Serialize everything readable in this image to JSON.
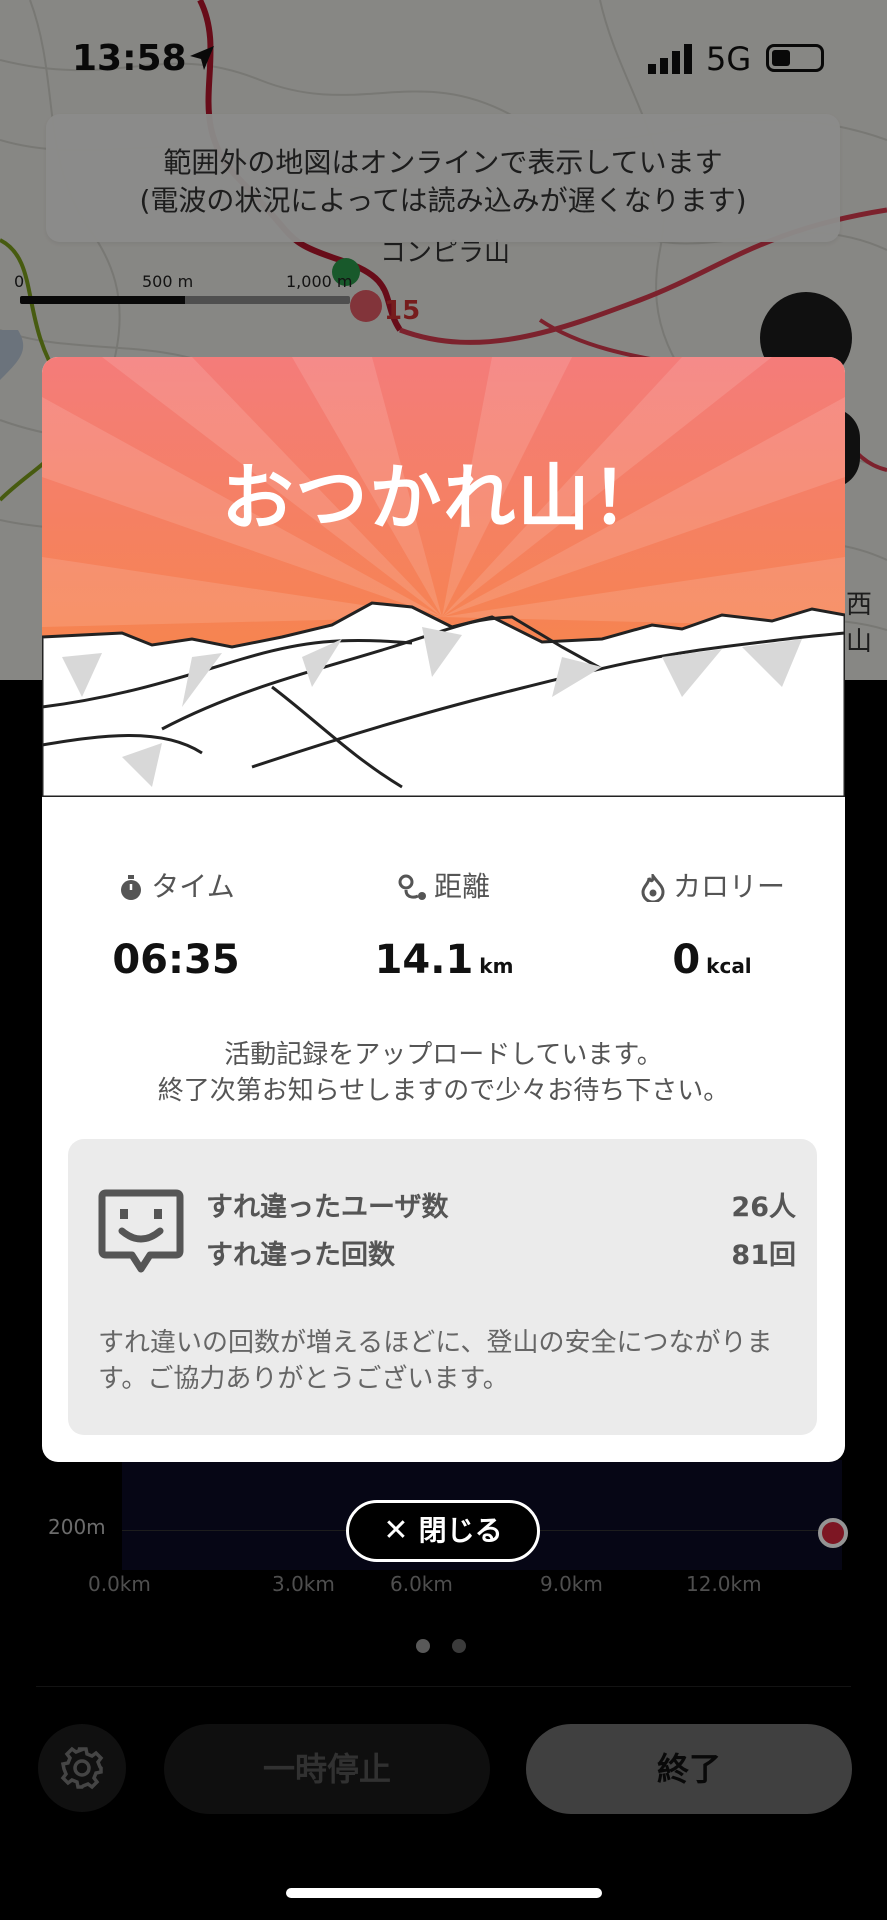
{
  "status_bar": {
    "time": "13:58",
    "network": "5G"
  },
  "map": {
    "notice_line1": "範囲外の地図はオンラインで表示しています",
    "notice_line2": "(電波の状況によっては読み込みが遅くなります)",
    "scale_labels": [
      "0",
      "500 m",
      "1,000 m"
    ],
    "waypoint_number": "15",
    "peak_label": "コンピラ山",
    "side_label": "西山"
  },
  "modal": {
    "title": "おつかれ山！",
    "stats": [
      {
        "label": "タイム",
        "value": "06:35",
        "unit": "",
        "icon": "stopwatch-icon"
      },
      {
        "label": "距離",
        "value": "14.1",
        "unit": "km",
        "icon": "route-pin-icon"
      },
      {
        "label": "カロリー",
        "value": "0",
        "unit": "kcal",
        "icon": "flame-icon"
      }
    ],
    "upload_line1": "活動記録をアップロードしています。",
    "upload_line2": "終了次第お知らせしますので少々お待ち下さい。",
    "pass": {
      "users_label": "すれ違ったユーザ数",
      "users_value": "26人",
      "count_label": "すれ違った回数",
      "count_value": "81回",
      "note": "すれ違いの回数が増えるほどに、登山の安全につながります。ご協力ありがとうございます。"
    }
  },
  "close_button": "閉じる",
  "elevation": {
    "y_label": "200m",
    "x_labels": [
      "0.0km",
      "3.0km",
      "6.0km",
      "9.0km",
      "12.0km"
    ]
  },
  "controls": {
    "pause_label": "一時停止",
    "end_label": "終了"
  },
  "colors": {
    "hero_top": "#f47c7a",
    "hero_bottom": "#f7883a",
    "end_dot": "#d7263d"
  }
}
